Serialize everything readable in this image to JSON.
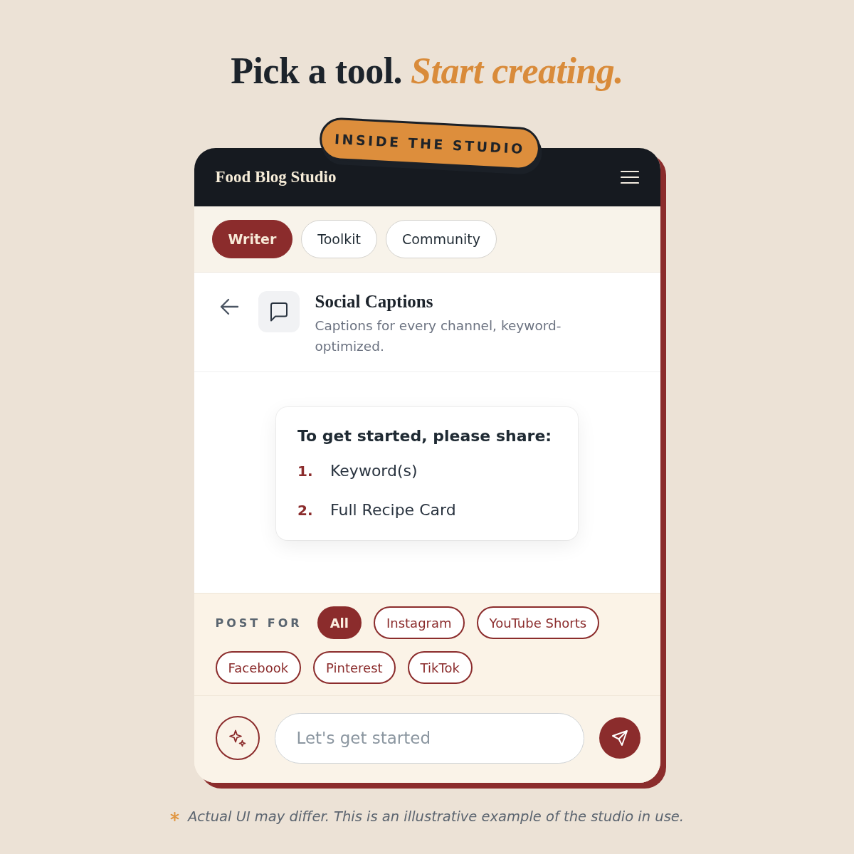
{
  "headline": {
    "text": "Pick a tool.",
    "accent": "Start creating."
  },
  "badge": "INSIDE THE STUDIO",
  "app": {
    "title": "Food Blog Studio"
  },
  "tabs": [
    {
      "label": "Writer",
      "selected": true
    },
    {
      "label": "Toolkit",
      "selected": false
    },
    {
      "label": "Community",
      "selected": false
    }
  ],
  "tool": {
    "name": "Social Captions",
    "description": "Captions for every channel, keyword-optimized."
  },
  "prompt": {
    "title": "To get started, please share:",
    "items": [
      {
        "number": "1.",
        "text": "Keyword(s)"
      },
      {
        "number": "2.",
        "text": "Full Recipe Card"
      }
    ]
  },
  "filters": {
    "label": "POST FOR",
    "chips": [
      {
        "label": "All",
        "selected": true
      },
      {
        "label": "Instagram",
        "selected": false
      },
      {
        "label": "YouTube Shorts",
        "selected": false
      },
      {
        "label": "Facebook",
        "selected": false
      },
      {
        "label": "Pinterest",
        "selected": false
      },
      {
        "label": "TikTok",
        "selected": false
      }
    ]
  },
  "composer": {
    "placeholder": "Let's get started"
  },
  "disclaimer": "Actual UI may differ. This is an illustrative example of the studio in use."
}
